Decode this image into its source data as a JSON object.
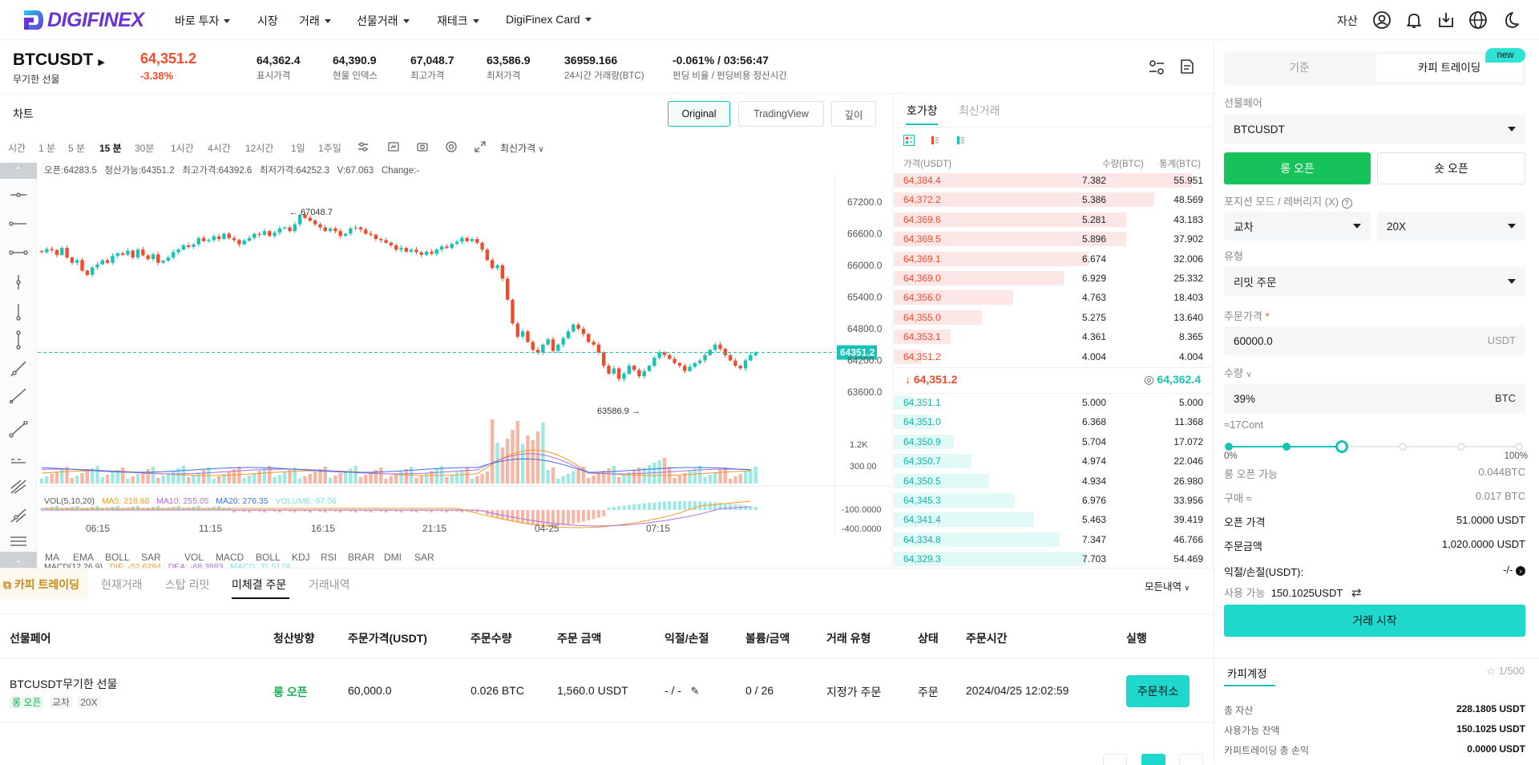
{
  "nav": {
    "logo_text": "DIGIFINEX",
    "items": [
      {
        "label": "바로 투자",
        "dropdown": true
      },
      {
        "label": "시장",
        "dropdown": false
      },
      {
        "label": "거래",
        "dropdown": true
      },
      {
        "label": "선물거래",
        "dropdown": true
      },
      {
        "label": "재테크",
        "dropdown": true
      },
      {
        "label": "DigiFinex Card",
        "dropdown": true
      }
    ],
    "asset_label": "자산",
    "icons": [
      "user-icon",
      "bell-icon",
      "download-icon",
      "globe-icon",
      "moon-icon"
    ]
  },
  "ticker": {
    "symbol": "BTCUSDT",
    "symbol_type": "무기한 선물",
    "last_price": "64,351.2",
    "change_pct": "-3.38%",
    "stats": [
      {
        "value": "64,362.4",
        "label": "표시가격"
      },
      {
        "value": "64,390.9",
        "label": "현물 인덱스"
      },
      {
        "value": "67,048.7",
        "label": "최고가격"
      },
      {
        "value": "63,586.9",
        "label": "최저가격"
      },
      {
        "value": "36959.166",
        "label": "24시간 거래량(BTC)"
      },
      {
        "value": "-0.061% / 03:56:47",
        "label": "펀딩 비율 / 펀딩비용 정산시간"
      }
    ]
  },
  "chart": {
    "title": "차트",
    "view_buttons": [
      "Original",
      "TradingView",
      "깊이"
    ],
    "active_view": "Original",
    "timeframes": [
      "시간",
      "1 분",
      "5 분",
      "15 분",
      "30분",
      "1시간",
      "4시간",
      "12시간",
      "1일",
      "1주일"
    ],
    "active_timeframe": "15 분",
    "price_type": "최신가격",
    "ohlc_line": {
      "open": "오픈:64283.5",
      "liq": "청산가능:64351.2",
      "high": "최고가격:64392.6",
      "low": "최저가격:64252.3",
      "vol": "V:67.063",
      "change": "Change:-"
    },
    "vol_legend": {
      "vol": "VOL(5,10,20)",
      "ma5": "MA5: 218.88",
      "ma10": "MA10: 255.05",
      "ma20": "MA20: 276.35",
      "volume": "VOLUME: 67.06"
    },
    "macd_legend": {
      "macd": "MACD(12,26,9)",
      "dif": "DIF: -52.6294",
      "dea": "DEA: -68.3883",
      "macd_val": "MACD: 31.5179"
    },
    "indicator_buttons": [
      "MA",
      "EMA",
      "BOLL",
      "SAR",
      "VOL",
      "MACD",
      "BOLL",
      "KDJ",
      "RSI",
      "BRAR",
      "DMI",
      "SAR"
    ],
    "colors": {
      "up": "#18c3b5",
      "down": "#ee4d2d",
      "ma5": "#f59a23",
      "ma10": "#b06ee0",
      "ma20": "#3c6fe0"
    }
  },
  "chart_data": {
    "type": "candlestick",
    "x_ticks": [
      "06:15",
      "11:15",
      "16:15",
      "21:15",
      "04-25",
      "07:15"
    ],
    "y_ticks": [
      67200.0,
      66600.0,
      66000.0,
      65400.0,
      64800.0,
      64200.0,
      63600.0
    ],
    "ylim": [
      63300,
      67600
    ],
    "last_price_label": "64351.2",
    "high_annotation": "67048.7",
    "low_annotation": "63586.9",
    "vol_ticks": [
      "1.2K",
      "300.00"
    ],
    "macd_ticks": [
      "-100.0000",
      "-400.0000"
    ],
    "close_series": [
      66250,
      66310,
      66290,
      66200,
      66330,
      66150,
      66050,
      66100,
      65900,
      65820,
      65960,
      66020,
      66100,
      66050,
      66180,
      66230,
      66200,
      66280,
      66150,
      66300,
      66190,
      66120,
      66210,
      66050,
      66090,
      66150,
      66250,
      66300,
      66380,
      66350,
      66400,
      66520,
      66460,
      66480,
      66550,
      66500,
      66600,
      66520,
      66480,
      66400,
      66470,
      66520,
      66600,
      66580,
      66650,
      66560,
      66620,
      66700,
      66720,
      66650,
      66780,
      66960,
      66900,
      66850,
      66780,
      66720,
      66650,
      66700,
      66650,
      66560,
      66600,
      66700,
      66720,
      66680,
      66600,
      66580,
      66500,
      66480,
      66430,
      66380,
      66300,
      66330,
      66260,
      66300,
      66250,
      66200,
      66260,
      66220,
      66300,
      66360,
      66330,
      66410,
      66450,
      66520,
      66460,
      66500,
      66430,
      66300,
      66100,
      65950,
      66000,
      65750,
      65350,
      64900,
      64650,
      64750,
      64550,
      64400,
      64350,
      64500,
      64600,
      64380,
      64500,
      64620,
      64750,
      64880,
      64800,
      64700,
      64550,
      64500,
      64350,
      64100,
      63950,
      64050,
      63850,
      63950,
      64100,
      64020,
      63900,
      64000,
      64100,
      64250,
      64350,
      64300,
      64230,
      64150,
      64100,
      64000,
      64080,
      64150,
      64200,
      64300,
      64400,
      64500,
      64420,
      64300,
      64200,
      64100,
      64050,
      64200,
      64300,
      64350
    ]
  },
  "orderbook": {
    "tabs": [
      "호가창",
      "최신거래"
    ],
    "active_tab": "호가창",
    "headers": [
      "가격(USDT)",
      "수량(BTC)",
      "통계(BTC)"
    ],
    "asks": [
      {
        "price": "64,384.4",
        "qty": "7.382",
        "total": "55.951",
        "depth": 0.95
      },
      {
        "price": "64,372.2",
        "qty": "5.386",
        "total": "48.569",
        "depth": 0.83
      },
      {
        "price": "64,369.6",
        "qty": "5.281",
        "total": "43.183",
        "depth": 0.74
      },
      {
        "price": "64,369.5",
        "qty": "5.896",
        "total": "37.902",
        "depth": 0.74
      },
      {
        "price": "64,369.1",
        "qty": "6.674",
        "total": "32.006",
        "depth": 0.62
      },
      {
        "price": "64,369.0",
        "qty": "6.929",
        "total": "25.332",
        "depth": 0.54
      },
      {
        "price": "64,356.0",
        "qty": "4.763",
        "total": "18.403",
        "depth": 0.38
      },
      {
        "price": "64,355.0",
        "qty": "5.275",
        "total": "13.640",
        "depth": 0.28
      },
      {
        "price": "64,353.1",
        "qty": "4.361",
        "total": "8.365",
        "depth": 0.18
      },
      {
        "price": "64,351.2",
        "qty": "4.004",
        "total": "4.004",
        "depth": 0.09
      }
    ],
    "mid_last": "64,351.2",
    "mid_mark": "64,362.4",
    "bids": [
      {
        "price": "64,351.1",
        "qty": "5.000",
        "total": "5.000",
        "depth": 0.09
      },
      {
        "price": "64,351.0",
        "qty": "6.368",
        "total": "11.368",
        "depth": 0.21
      },
      {
        "price": "64,350.9",
        "qty": "5.704",
        "total": "17.072",
        "depth": 0.31
      },
      {
        "price": "64,350.7",
        "qty": "4.974",
        "total": "22.046",
        "depth": 0.4
      },
      {
        "price": "64,350.5",
        "qty": "4.934",
        "total": "26.980",
        "depth": 0.49
      },
      {
        "price": "64,345.3",
        "qty": "6.976",
        "total": "33.956",
        "depth": 0.62
      },
      {
        "price": "64,341.4",
        "qty": "5.463",
        "total": "39.419",
        "depth": 0.72
      },
      {
        "price": "64,334.8",
        "qty": "7.347",
        "total": "46.766",
        "depth": 0.85
      },
      {
        "price": "64,329.3",
        "qty": "7.703",
        "total": "54.469",
        "depth": 0.99
      }
    ]
  },
  "trade": {
    "tabs": [
      "기준",
      "카피 트레이딩"
    ],
    "active_tab": "카피 트레이딩",
    "new_badge": "new",
    "pair_label": "선물페어",
    "pair_value": "BTCUSDT",
    "long_btn": "롱 오픈",
    "short_btn": "숏 오픈",
    "mode_label": "포지션 모드 / 레버리지 (X)",
    "margin_mode": "교차",
    "leverage": "20X",
    "type_label": "유형",
    "order_type": "리밋 주문",
    "price_label": "주문가격",
    "price_required": "*",
    "price_value": "60000.0",
    "price_unit": "USDT",
    "qty_label": "수량",
    "qty_value": "39%",
    "qty_unit": "BTC",
    "cont_text": "≈17Cont",
    "slider_pct": 39,
    "slider_min": "0%",
    "slider_max": "100%",
    "rows": [
      {
        "k": "롱 오픈 가능",
        "v": "0.044BTC",
        "style": "muted"
      },
      {
        "k": "구매 ≈",
        "v": "0.017 BTC",
        "style": "muted"
      },
      {
        "k": "오픈 가격",
        "v": "51.0000 USDT",
        "style": "dark"
      },
      {
        "k": "주문금액",
        "v": "1,020.0000 USDT",
        "style": "dark"
      }
    ],
    "pnl_label": "익절/손절(USDT):",
    "pnl_value": "-/-",
    "available_label": "사용 가능",
    "available_value": "150.1025USDT",
    "start_btn": "거래 시작",
    "copy_account_title": "카피계정",
    "copy_count": "1/500",
    "account_rows": [
      {
        "k": "총 자산",
        "v": "228.1805 USDT"
      },
      {
        "k": "사용가능 잔액",
        "v": "150.1025 USDT"
      },
      {
        "k": "카피트레이딩 총 손익",
        "v": "0.0000 USDT"
      }
    ]
  },
  "orders": {
    "tabs": [
      "카피 트레이딩",
      "현재거래",
      "스탑 리밋",
      "미체결 주문",
      "거래내역"
    ],
    "active_tab": "미체결 주문",
    "filter": "모든내역",
    "headers": [
      "선물페어",
      "청산방향",
      "주문가격(USDT)",
      "주문수량",
      "주문 금액",
      "익절/손절",
      "볼륨/금액",
      "거래 유형",
      "상태",
      "주문시간",
      "실행"
    ],
    "row": {
      "pair": "BTCUSDT무기한 선물",
      "tags": [
        "롱 오픈",
        "교차",
        "20X"
      ],
      "direction": "롱 오픈",
      "price": "60,000.0",
      "qty": "0.026 BTC",
      "amount": "1,560.0 USDT",
      "tpsl": "- / -",
      "filled": "0 / 26",
      "type": "지정가 주문",
      "status": "주문",
      "time": "2024/04/25 12:02:59",
      "action": "주문취소"
    }
  }
}
